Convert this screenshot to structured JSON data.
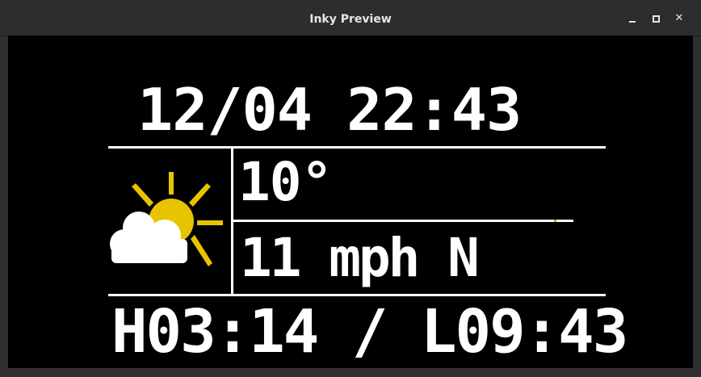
{
  "window": {
    "title": "Inky Preview",
    "controls": {
      "minimize": "–",
      "maximize": "□",
      "close": "✕"
    }
  },
  "display": {
    "datetime": "12/04 22:43",
    "temperature": "10°",
    "wind": "11 mph N",
    "tides": "H03:14 / L09:43",
    "weather_icon": "partly-cloudy-icon",
    "colors": {
      "background": "#000000",
      "foreground": "#ffffff",
      "sun": "#e8c400"
    }
  }
}
